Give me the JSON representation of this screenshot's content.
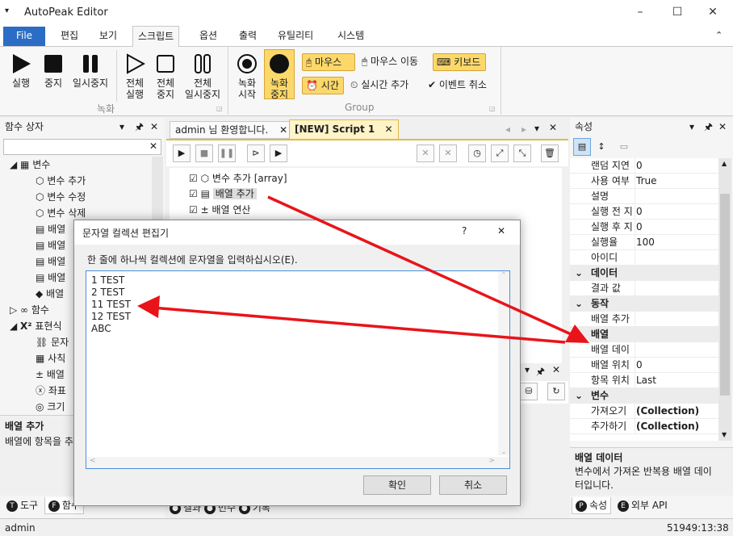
{
  "window": {
    "title": "AutoPeak Editor",
    "controls": [
      "–",
      "☐",
      "✕"
    ]
  },
  "menu": {
    "file": "File",
    "tabs": [
      "편집",
      "보기",
      "스크립트",
      "옵션",
      "출력",
      "유틸리티",
      "시스템"
    ],
    "active_tab": "스크립트"
  },
  "ribbon": {
    "record_group": {
      "label": "녹화",
      "buttons": [
        {
          "label1": "실행",
          "label2": ""
        },
        {
          "label1": "중지",
          "label2": ""
        },
        {
          "label1": "일시중지",
          "label2": ""
        },
        {
          "label1": "전체",
          "label2": "실행"
        },
        {
          "label1": "전체",
          "label2": "중지"
        },
        {
          "label1": "전체",
          "label2": "일시중지"
        }
      ]
    },
    "group": {
      "label": "Group",
      "rec_start": {
        "label1": "녹화",
        "label2": "시작"
      },
      "rec_stop": {
        "label1": "녹화",
        "label2": "중지"
      },
      "mouse": "마우스",
      "mouse_move": "마우스 이동",
      "keyboard": "키보드",
      "time": "시간",
      "realtime_add": "실시간 추가",
      "event_cancel": "이벤트 취소"
    }
  },
  "left_panel": {
    "title": "함수 상자",
    "search_value": "",
    "tree": {
      "variables": "변수",
      "var_items": [
        "변수 추가",
        "변수 수정",
        "변수 삭제",
        "배열",
        "배열",
        "배열",
        "배열",
        "배열"
      ],
      "functions": "함수",
      "expressions": "표현식",
      "expr_items": [
        "문자",
        "사칙",
        "배열",
        "좌표",
        "크기"
      ]
    },
    "desc_title": "배열 추가",
    "desc_text": "배열에 항목을 추",
    "bottom_tabs": [
      "도구",
      "함수"
    ]
  },
  "editor": {
    "tabs": [
      "admin 님 환영합니다.",
      "[NEW] Script 1"
    ],
    "active_tab": "[NEW] Script 1",
    "script_rows": [
      {
        "text": "변수 추가",
        "extra": " [array]"
      },
      {
        "text": "배열 추가",
        "extra": ""
      },
      {
        "text": "배열 연산",
        "extra": ""
      }
    ],
    "bottom_tabs": [
      "결과",
      "번수",
      "기록"
    ]
  },
  "properties": {
    "title": "속성",
    "rows": [
      {
        "type": "row",
        "key": "랜덤 지연",
        "value": "0"
      },
      {
        "type": "row",
        "key": "사용 여부",
        "value": "True"
      },
      {
        "type": "row",
        "key": "설명",
        "value": ""
      },
      {
        "type": "row",
        "key": "실행 전 지",
        "value": "0"
      },
      {
        "type": "row",
        "key": "실행 후 지",
        "value": "0"
      },
      {
        "type": "row",
        "key": "실행율",
        "value": "100"
      },
      {
        "type": "row",
        "key": "아이디",
        "value": ""
      },
      {
        "type": "cat",
        "key": "데이터"
      },
      {
        "type": "row",
        "key": "결과 값",
        "value": ""
      },
      {
        "type": "cat",
        "key": "동작"
      },
      {
        "type": "row",
        "key": "배열 추가",
        "value": ""
      },
      {
        "type": "cat",
        "key": "배열"
      },
      {
        "type": "row",
        "key": "배열 데이",
        "value": ""
      },
      {
        "type": "row",
        "key": "배열 위치",
        "value": "0"
      },
      {
        "type": "row",
        "key": "항목 위치",
        "value": "Last"
      },
      {
        "type": "cat",
        "key": "변수"
      },
      {
        "type": "row",
        "key": "가져오기",
        "value": "(Collection)",
        "bold": true
      },
      {
        "type": "row",
        "key": "추가하기",
        "value": "(Collection)",
        "bold": true
      }
    ],
    "desc_title": "배열 데이터",
    "desc_text1": "변수에서 가져온 반복용 배열 데이",
    "desc_text2": "터입니다.",
    "bottom_tabs": [
      "속성",
      "외부 API"
    ]
  },
  "dialog": {
    "title": "문자열 컬렉션 편집기",
    "help": "?",
    "close": "✕",
    "instruction": "한 줄에 하나씩 컬렉션에 문자열을 입력하십시오(E).",
    "lines": [
      "1 TEST",
      "2 TEST",
      "11 TEST",
      "12 TEST",
      "ABC"
    ],
    "ok": "확인",
    "cancel": "취소"
  },
  "status": {
    "user": "admin",
    "clock": "51949:13:38"
  },
  "colors": {
    "accent": "#2b6cc4",
    "highlight": "#fcd86a",
    "arrow": "#e8141a"
  }
}
